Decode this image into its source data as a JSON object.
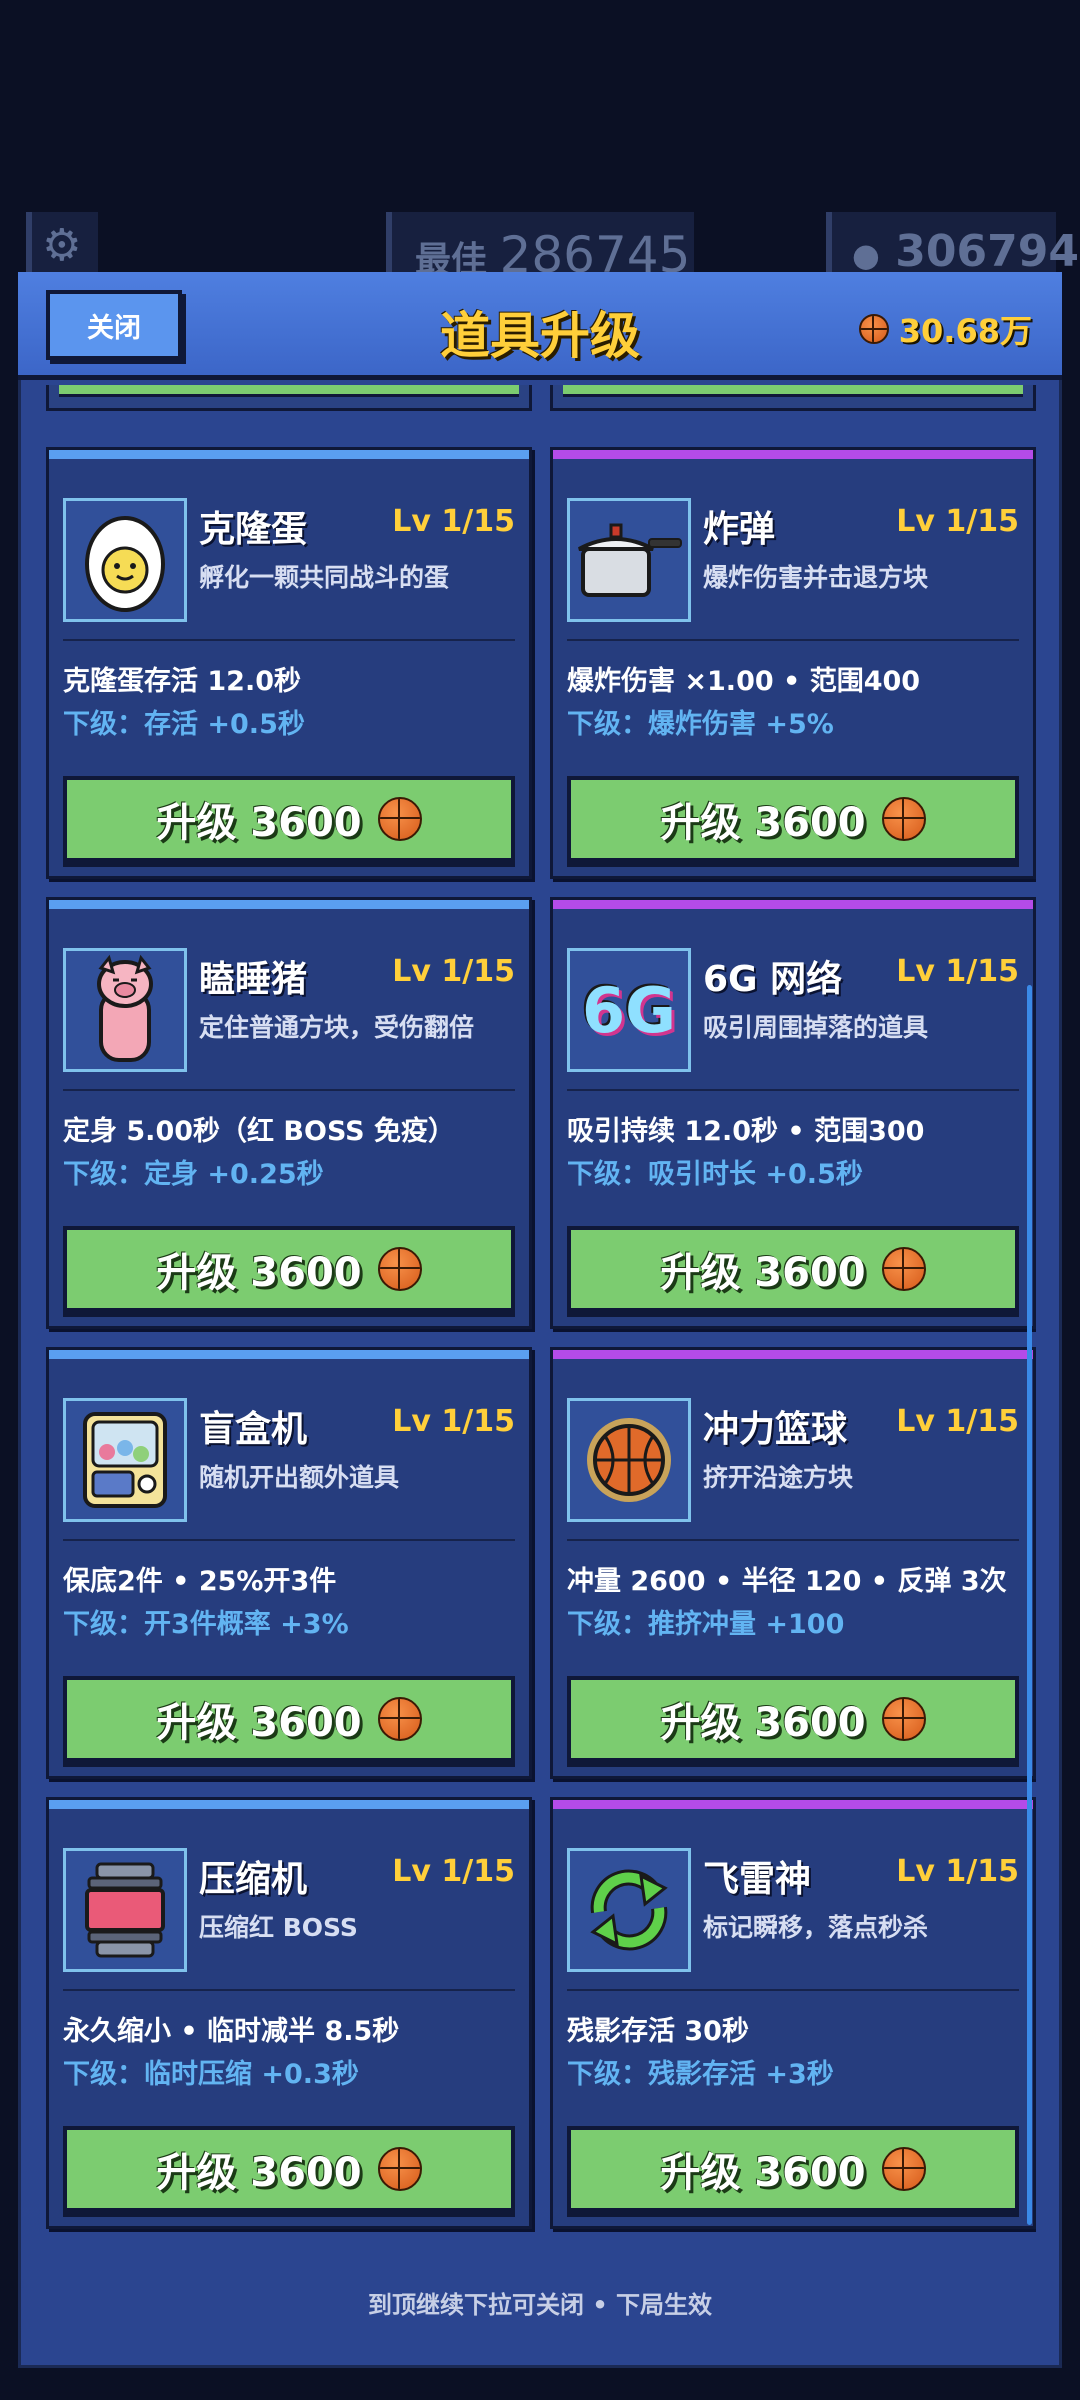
{
  "hud": {
    "best_label": "最佳",
    "best_value": "286745",
    "score": "306794"
  },
  "header": {
    "close_label": "关闭",
    "title": "道具升级",
    "coins": "30.68万"
  },
  "items": [
    {
      "name": "克隆蛋",
      "level": "Lv 1/15",
      "desc": "孵化一颗共同战斗的蛋",
      "stat": "克隆蛋存活 12.0秒",
      "next": "下级：存活 +0.5秒",
      "button": "升级 3600",
      "icon": "egg-icon",
      "accent": "blue"
    },
    {
      "name": "炸弹",
      "level": "Lv 1/15",
      "desc": "爆炸伤害并击退方块",
      "stat": "爆炸伤害 ×1.00 • 范围400",
      "next": "下级：爆炸伤害 +5%",
      "button": "升级 3600",
      "icon": "pressure-cooker-icon",
      "accent": "purple"
    },
    {
      "name": "瞌睡猪",
      "level": "Lv 1/15",
      "desc": "定住普通方块，受伤翻倍",
      "stat": "定身 5.00秒（红 BOSS 免疫）",
      "next": "下级：定身 +0.25秒",
      "button": "升级 3600",
      "icon": "pig-icon",
      "accent": "blue"
    },
    {
      "name": "6G 网络",
      "level": "Lv 1/15",
      "desc": "吸引周围掉落的道具",
      "stat": "吸引持续 12.0秒 • 范围300",
      "next": "下级：吸引时长 +0.5秒",
      "button": "升级 3600",
      "icon": "6g-icon",
      "icon_text": "6G",
      "accent": "purple"
    },
    {
      "name": "盲盒机",
      "level": "Lv 1/15",
      "desc": "随机开出额外道具",
      "stat": "保底2件 • 25%开3件",
      "next": "下级：开3件概率 +3%",
      "button": "升级 3600",
      "icon": "gacha-machine-icon",
      "accent": "blue"
    },
    {
      "name": "冲力篮球",
      "level": "Lv 1/15",
      "desc": "挤开沿途方块",
      "stat": "冲量 2600 • 半径 120 • 反弹 3次",
      "next": "下级：推挤冲量 +100",
      "button": "升级 3600",
      "icon": "basketball-icon",
      "accent": "purple"
    },
    {
      "name": "压缩机",
      "level": "Lv 1/15",
      "desc": "压缩红 BOSS",
      "stat": "永久缩小 • 临时减半 8.5秒",
      "next": "下级：临时压缩 +0.3秒",
      "button": "升级 3600",
      "icon": "compressor-icon",
      "accent": "blue"
    },
    {
      "name": "飞雷神",
      "level": "Lv 1/15",
      "desc": "标记瞬移，落点秒杀",
      "stat": "残影存活 30秒",
      "next": "下级：残影存活 +3秒",
      "button": "升级 3600",
      "icon": "recycle-arrows-icon",
      "accent": "purple"
    }
  ],
  "footer": "到顶继续下拉可关闭 • 下局生效",
  "colors": {
    "gold": "#ffcf3a",
    "button_green": "#7ccc70",
    "accent_blue": "#5a9ef0",
    "accent_purple": "#b44be8",
    "next_text": "#62b4f2"
  }
}
